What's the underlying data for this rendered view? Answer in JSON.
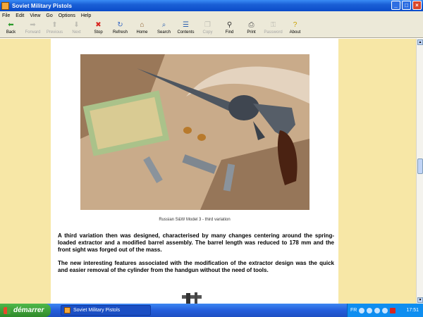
{
  "window": {
    "title": "Soviet Military Pistols"
  },
  "menu": [
    "File",
    "Edit",
    "View",
    "Go",
    "Options",
    "Help"
  ],
  "toolbar": [
    {
      "label": "Back",
      "icon": "back-arrow-icon",
      "glyph": "⬅",
      "enabled": true,
      "color": "#2a9a2a"
    },
    {
      "label": "Forward",
      "icon": "forward-arrow-icon",
      "glyph": "➡",
      "enabled": false,
      "color": "#888888"
    },
    {
      "label": "Previous",
      "icon": "up-arrow-icon",
      "glyph": "⬆",
      "enabled": false,
      "color": "#888888"
    },
    {
      "label": "Next",
      "icon": "down-arrow-icon",
      "glyph": "⬇",
      "enabled": false,
      "color": "#888888"
    },
    {
      "label": "Stop",
      "icon": "stop-icon",
      "glyph": "✖",
      "enabled": true,
      "color": "#d8251f"
    },
    {
      "label": "Refresh",
      "icon": "refresh-icon",
      "glyph": "↻",
      "enabled": true,
      "color": "#3a6bc4"
    },
    {
      "label": "Home",
      "icon": "home-icon",
      "glyph": "⌂",
      "enabled": true,
      "color": "#8a5a2b"
    },
    {
      "label": "Search",
      "icon": "search-icon",
      "glyph": "⌕",
      "enabled": true,
      "color": "#2b5fb0"
    },
    {
      "label": "Contents",
      "icon": "contents-icon",
      "glyph": "☰",
      "enabled": true,
      "color": "#2b5fb0"
    },
    {
      "label": "Copy",
      "icon": "copy-icon",
      "glyph": "❐",
      "enabled": false,
      "color": "#888888"
    },
    {
      "label": "Find",
      "icon": "binoculars-icon",
      "glyph": "⚲",
      "enabled": true,
      "color": "#333333"
    },
    {
      "label": "Print",
      "icon": "print-icon",
      "glyph": "⎙",
      "enabled": true,
      "color": "#555555"
    },
    {
      "label": "Password",
      "icon": "password-icon",
      "glyph": "⚿",
      "enabled": false,
      "color": "#888888"
    },
    {
      "label": "About",
      "icon": "about-icon",
      "glyph": "?",
      "enabled": true,
      "color": "#c8a000"
    }
  ],
  "page": {
    "caption": "Russian S&W Model 3 - third variation",
    "paragraphs": [
      "A third variation then was designed, characterised by many changes centering around the spring-loaded extractor and a modified barrel assembly. The barrel length was reduced to 178 mm and the front sight was forged out of the mass.",
      "The new interesting features associated with the modification of the extractor design was the quick and easier removal of the cylinder from the handgun without the need of tools."
    ]
  },
  "taskbar": {
    "start_label": "démarrer",
    "task_label": "Soviet Military Pistols",
    "language": "FR",
    "clock": "17:51"
  }
}
